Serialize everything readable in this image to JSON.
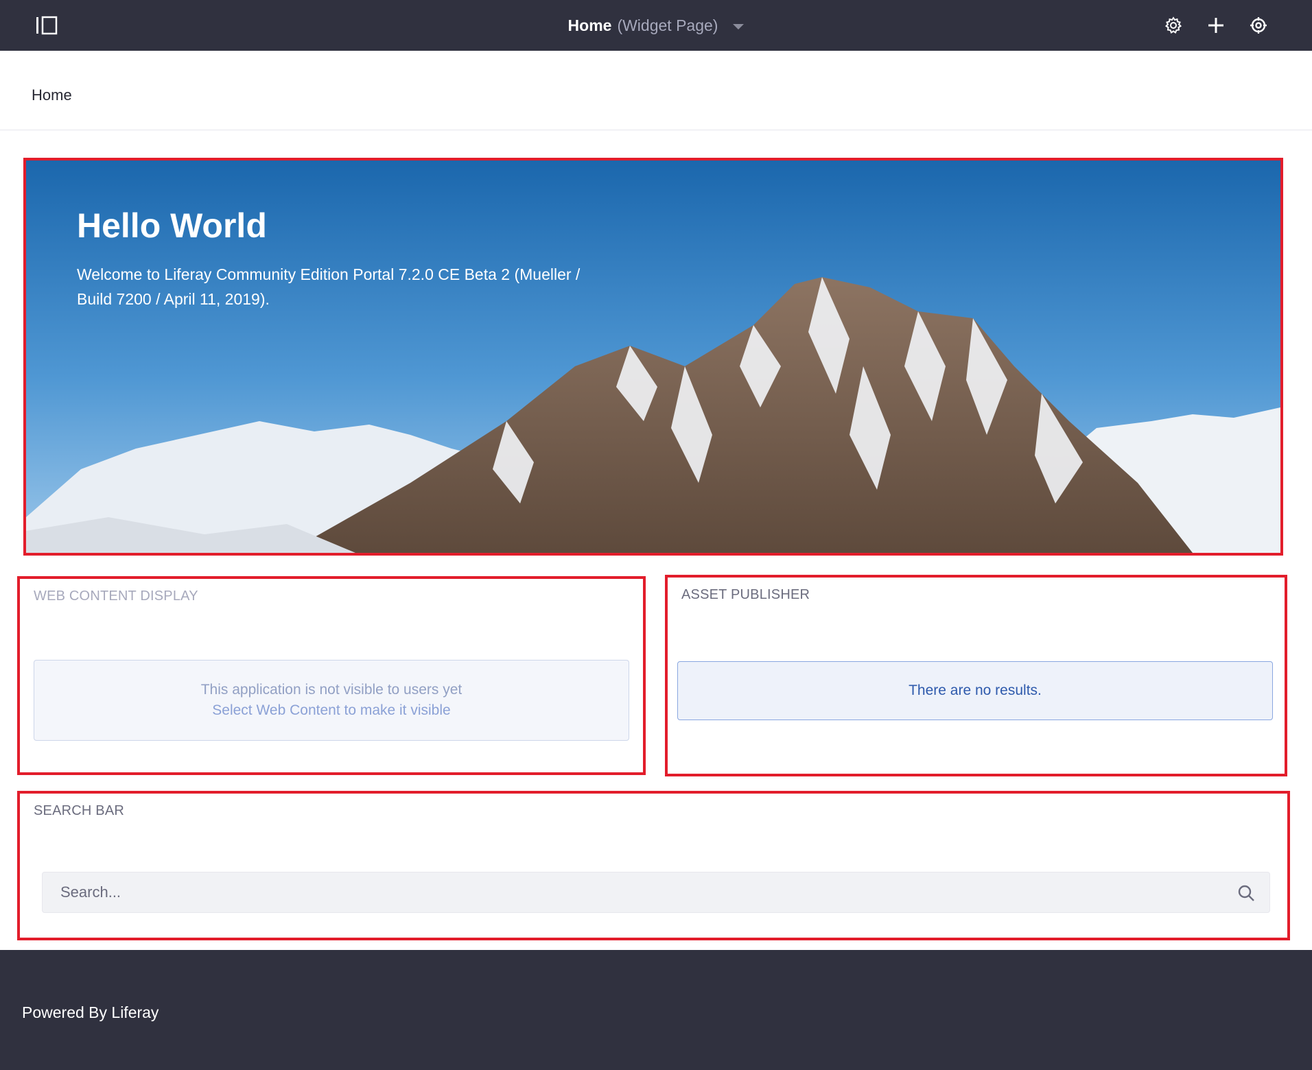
{
  "control_menu": {
    "page_name": "Home",
    "page_type": "(Widget Page)",
    "icons": [
      "product-menu-toggle-icon",
      "gear-icon",
      "plus-icon",
      "simulation-icon"
    ]
  },
  "navigation": {
    "home_label": "Home"
  },
  "hero": {
    "title": "Hello World",
    "text": "Welcome to Liferay Community Edition Portal 7.2.0 CE Beta 2 (Mueller / Build 7200 / April 11, 2019)."
  },
  "web_content_display": {
    "title": "WEB CONTENT DISPLAY",
    "message_line1": "This application is not visible to users yet",
    "message_link": "Select Web Content to make it visible"
  },
  "asset_publisher": {
    "title": "ASSET PUBLISHER",
    "message": "There are no results."
  },
  "search_bar": {
    "title": "SEARCH BAR",
    "placeholder": "Search...",
    "icon": "search-icon"
  },
  "footer": {
    "text": "Powered By Liferay"
  },
  "colors": {
    "header_bg": "#30313f",
    "highlight_border": "#e21d2b",
    "info_text": "#2e5aac"
  }
}
